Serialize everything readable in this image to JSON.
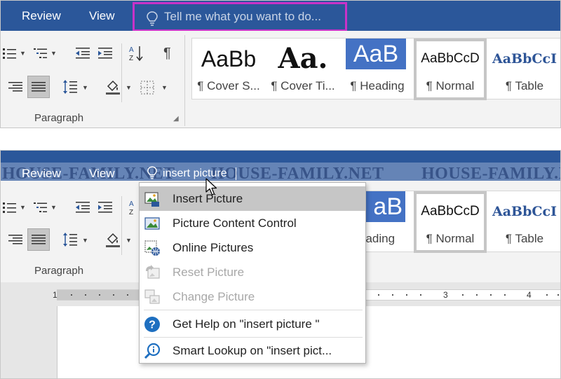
{
  "top_panel": {
    "menu": {
      "review": "Review",
      "view": "View"
    },
    "tell_me": {
      "placeholder": "Tell me what you want to do..."
    },
    "paragraph_group": {
      "label": "Paragraph"
    },
    "styles": [
      {
        "sample": "AaBb",
        "name": "¶ Cover S..."
      },
      {
        "sample": "Aa.",
        "name": "¶ Cover Ti..."
      },
      {
        "sample": "AaB",
        "name": "¶ Heading"
      },
      {
        "sample": "AaBbCcD",
        "name": "¶ Normal"
      },
      {
        "sample": "AaBbCcI",
        "name": "¶ Table"
      }
    ]
  },
  "bottom_panel": {
    "menu": {
      "review": "Review",
      "view": "View"
    },
    "search": {
      "value": "insert picture"
    },
    "watermark": [
      "HOUSE-FAMILY.NET",
      "HOUSE-FAMILY.NET",
      "HOUSE-FAMILY.NET"
    ],
    "paragraph_group": {
      "label": "Paragraph"
    },
    "styles": [
      {
        "sample": "aB",
        "name": "eading"
      },
      {
        "sample": "AaBbCcD",
        "name": "¶ Normal"
      },
      {
        "sample": "AaBbCcI",
        "name": "¶ Table"
      }
    ],
    "ruler": {
      "marks": [
        "1",
        "3",
        "4"
      ]
    },
    "dropdown": {
      "items": [
        {
          "label": "Insert Picture",
          "icon": "insert-picture-icon",
          "highlighted": true,
          "enabled": true
        },
        {
          "label": "Picture Content Control",
          "icon": "picture-content-control-icon",
          "enabled": true
        },
        {
          "label": "Online Pictures",
          "icon": "online-pictures-icon",
          "enabled": true
        },
        {
          "label": "Reset Picture",
          "icon": "reset-picture-icon",
          "enabled": false
        },
        {
          "label": "Change Picture",
          "icon": "change-picture-icon",
          "enabled": false
        },
        {
          "label": "Get Help on \"insert picture \"",
          "icon": "help-icon",
          "enabled": true
        },
        {
          "label": "Smart Lookup on \"insert pict...",
          "icon": "smart-lookup-icon",
          "enabled": true
        }
      ]
    }
  },
  "colors": {
    "ribbon_blue": "#2b579a",
    "tell_me_highlight": "#c832c8",
    "heading_style_bg": "#4472c4",
    "table_style_text": "#2e5597",
    "help_icon_blue": "#1e6fc0"
  }
}
